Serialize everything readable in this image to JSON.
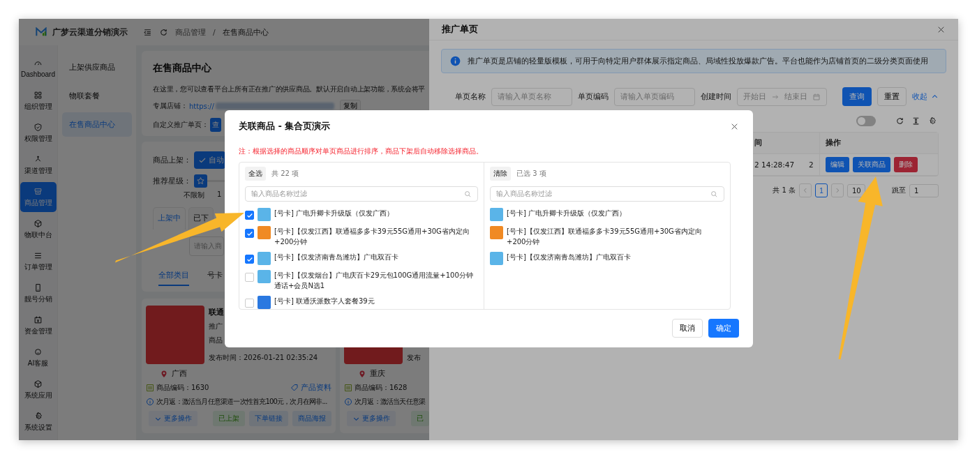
{
  "app": {
    "title": "广梦云渠道分销演示"
  },
  "breadcrumb": {
    "items": [
      "商品管理",
      "在售商品中心"
    ],
    "separator": "/"
  },
  "sidebar": {
    "items": [
      {
        "label": "Dashboard",
        "selected": false
      },
      {
        "label": "组织管理",
        "selected": false
      },
      {
        "label": "权限管理",
        "selected": false
      },
      {
        "label": "渠道管理",
        "selected": false
      },
      {
        "label": "商品管理",
        "selected": true
      },
      {
        "label": "物联中台",
        "selected": false
      },
      {
        "label": "订单管理",
        "selected": false
      },
      {
        "label": "靓号分销",
        "selected": false
      },
      {
        "label": "资金管理",
        "selected": false
      },
      {
        "label": "AI客服",
        "selected": false
      },
      {
        "label": "系统应用",
        "selected": false
      },
      {
        "label": "系统设置",
        "selected": false
      }
    ]
  },
  "submenu": {
    "items": [
      {
        "label": "上架供应商品",
        "selected": false
      },
      {
        "label": "物联套餐",
        "selected": false
      },
      {
        "label": "在售商品中心",
        "selected": true
      }
    ]
  },
  "intro": {
    "title": "在售商品中心",
    "description": "在这里，您可以查看平台上所有正在推广的供应商品。默认开启自动上架功能，系统会将平",
    "store_label": "专属店铺：",
    "store_url": "https://",
    "copy_button": "复制",
    "custom_page_label": "自定义推广单页：",
    "view_button": "查"
  },
  "filters": {
    "listing_label": "商品上架：",
    "auto_button": "自动",
    "rating_label": "推荐星级：",
    "rating": {
      "level": 0,
      "ticks": [
        "不限制",
        "1"
      ]
    },
    "status_tabs": [
      {
        "label": "上架中",
        "selected": true
      },
      {
        "label": "已下",
        "selected": false
      }
    ],
    "keyword_placeholder": "请输入商",
    "category_tabs": [
      {
        "label": "全部类目",
        "selected": true
      },
      {
        "label": "号卡",
        "selected": false
      }
    ]
  },
  "products": [
    {
      "title": "联通",
      "promo": "推广",
      "goods": "商品",
      "published": "发布时间：2026-01-21 02:35:24",
      "region": "广西",
      "code": "商品编码：1630",
      "info_link": "产品资料",
      "rebate": "次月返：激活当月任意渠道一次性首充100元，次月在网非...",
      "actions": [
        {
          "label": "更多操作",
          "kind": "more"
        },
        {
          "label": "已上架",
          "kind": "status"
        },
        {
          "label": "下单链接",
          "kind": "link"
        },
        {
          "label": "商品海报",
          "kind": "link"
        }
      ]
    },
    {
      "published": "发布",
      "region": "重庆",
      "code": "商品编码：1628",
      "rebate": "次月返：激活当天任意渠",
      "actions": [
        {
          "label": "更多操作",
          "kind": "more"
        },
        {
          "label": "已",
          "kind": "status"
        }
      ]
    }
  ],
  "drawer": {
    "title": "推广单页",
    "notice": "推广单页是店铺的轻量版模板，可用于向特定用户群体展示指定商品、局域性投放爆款广告。平台也能作为店铺首页的二级分类页面使用",
    "form": [
      {
        "kind": "text",
        "label": "单页名称",
        "placeholder": "请输入单页名称"
      },
      {
        "kind": "text",
        "label": "单页编码",
        "placeholder": "请输入单页编码"
      },
      {
        "kind": "range",
        "label": "创建时间",
        "start_placeholder": "开始日",
        "end_placeholder": "结束日"
      }
    ],
    "query_button": "查询",
    "reset_button": "重置",
    "collapse_link": "收起",
    "switch": {
      "on": false
    },
    "table": {
      "time_header": "间",
      "action_header": "操作",
      "rows": [
        {
          "time": "2 14:28:47",
          "column_2": "2",
          "actions": [
            {
              "label": "编辑",
              "kind": "primary"
            },
            {
              "label": "关联商品",
              "kind": "primary"
            },
            {
              "label": "删除",
              "kind": "danger"
            }
          ]
        }
      ]
    },
    "pagination": {
      "total": "共 1 条",
      "pages": [
        {
          "label": "1",
          "selected": true
        }
      ],
      "page_size": "10",
      "jump_label": "跳至",
      "jump_value": "1"
    }
  },
  "modal": {
    "title": "关联商品 - 集合页演示",
    "note": "注：根据选择的商品顺序对单页商品进行排序，商品下架后自动移除选择商品。",
    "source": {
      "select_all": "全选",
      "count": "共 22 项",
      "placeholder": "输入商品名称过滤",
      "items": [
        {
          "label": "[号卡] 广电升卿卡升级版（仅发广西）",
          "checked": true,
          "color": "#5ab4e8"
        },
        {
          "label": "[号卡]【仅发江西】联通福多多卡39元55G通用+30G省内定向+200分钟",
          "checked": true,
          "color": "#f08a24"
        },
        {
          "label": "[号卡]【仅发济南青岛潍坊】广电双百卡",
          "checked": true,
          "color": "#5ab4e8"
        },
        {
          "label": "[号卡]【仅发烟台】广电庆百卡29元包100G通用流量+100分钟通话+会员N选1",
          "checked": false,
          "color": "#5ab4e8"
        },
        {
          "label": "[号卡] 联通沃派数字人套餐39元",
          "checked": false,
          "color": "#2a78e0"
        }
      ]
    },
    "target": {
      "clear": "清除",
      "count": "已选 3 项",
      "placeholder": "输入商品名称过滤",
      "items": [
        {
          "label": "[号卡] 广电升卿卡升级版（仅发广西）",
          "color": "#5ab4e8"
        },
        {
          "label": "[号卡]【仅发江西】联通福多多卡39元55G通用+30G省内定向+200分钟",
          "color": "#f08a24"
        },
        {
          "label": "[号卡]【仅发济南青岛潍坊】广电双百卡",
          "color": "#5ab4e8"
        }
      ]
    },
    "cancel_button": "取消",
    "confirm_button": "确定"
  }
}
